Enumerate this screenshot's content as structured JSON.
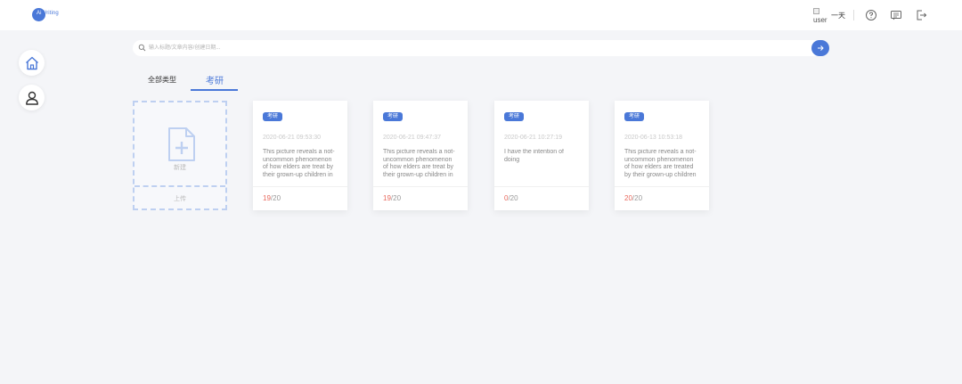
{
  "app": {
    "logo_prefix": "Ai",
    "logo_text": "Writing",
    "user_alt": "user",
    "user_name": "一天"
  },
  "search": {
    "placeholder": "输入标题/文章内容/创建日期..."
  },
  "tabs": [
    {
      "label": "全部类型"
    },
    {
      "label": "考研"
    }
  ],
  "new_card": {
    "new_label": "新建",
    "upload_label": "上传"
  },
  "cards": [
    {
      "tag": "考研",
      "date": "2020-06-21   09:53:30",
      "excerpt": "This picture reveals a not-uncommon phenomenon of how elders are treat by their grown-up children in",
      "count_num": "19",
      "count_total": "/20"
    },
    {
      "tag": "考研",
      "date": "2020-06-21   09:47:37",
      "excerpt": "This picture reveals a not-uncommon phenomenon of how elders are treat by their grown-up children in",
      "count_num": "19",
      "count_total": "/20"
    },
    {
      "tag": "考研",
      "date": "2020-06-21   10:27:19",
      "excerpt": "I have the intention of doing",
      "count_num": "0",
      "count_total": "/20"
    },
    {
      "tag": "考研",
      "date": "2020-06-13   10:53:18",
      "excerpt": "This picture reveals a not-uncommon phenomenon of how elders are treated by their grown-up children",
      "count_num": "20",
      "count_total": "/20"
    }
  ],
  "colors": {
    "accent": "#4a78d8",
    "count_highlight": "#e8685c",
    "background": "#f4f5f8"
  },
  "icons": {
    "logo": "logo-icon",
    "help": "help-icon",
    "message": "message-icon",
    "logout": "logout-icon",
    "home": "home-icon",
    "profile": "user-icon",
    "search": "search-icon",
    "submit": "arrow-right-icon",
    "new_file": "file-add-icon"
  }
}
